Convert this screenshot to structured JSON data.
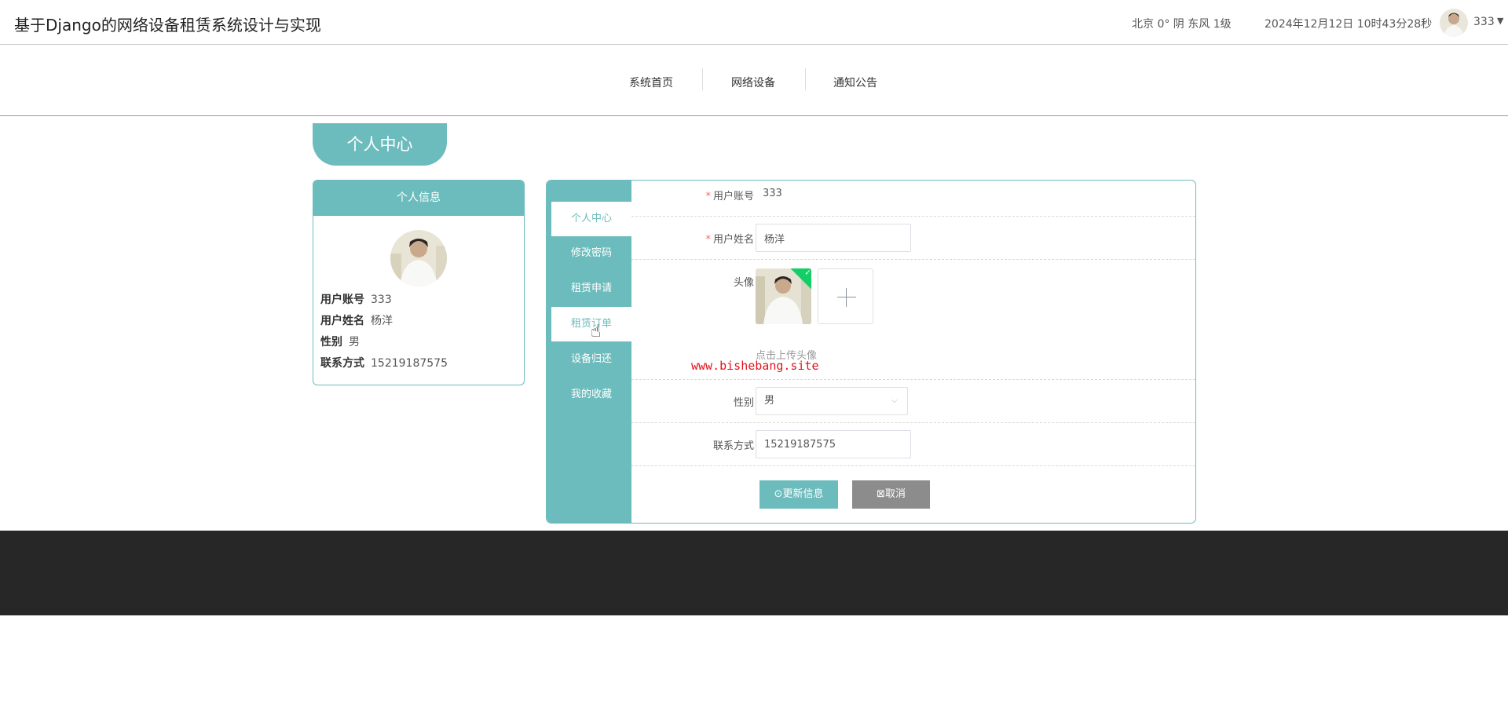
{
  "header": {
    "site_title": "基于Django的网络设备租赁系统设计与实现",
    "weather": "北京  0°  阴  东风  1级",
    "datetime": "2024年12月12日 10时43分28秒",
    "username": "333",
    "avatar_icon": "user-avatar-icon"
  },
  "nav": {
    "items": [
      {
        "label": "系统首页"
      },
      {
        "label": "网络设备"
      },
      {
        "label": "通知公告"
      }
    ]
  },
  "page": {
    "title_tab": "个人中心"
  },
  "profile_card": {
    "title": "个人信息",
    "rows": [
      {
        "key": "用户账号",
        "value": "333"
      },
      {
        "key": "用户姓名",
        "value": "杨洋"
      },
      {
        "key": "性别",
        "value": "男"
      },
      {
        "key": "联系方式",
        "value": "15219187575"
      }
    ]
  },
  "side_menu": {
    "items": [
      {
        "label": "个人中心",
        "active": true
      },
      {
        "label": "修改密码"
      },
      {
        "label": "租赁申请"
      },
      {
        "label": "租赁订单"
      },
      {
        "label": "设备归还"
      },
      {
        "label": "我的收藏"
      }
    ]
  },
  "form": {
    "account_label": "用户账号",
    "account_value": "333",
    "name_label": "用户姓名",
    "name_value": "杨洋",
    "avatar_label": "头像",
    "upload_tip": "点击上传头像",
    "gender_label": "性别",
    "gender_value": "男",
    "phone_label": "联系方式",
    "phone_value": "15219187575",
    "update_button": "更新信息",
    "cancel_button": "取消"
  },
  "watermark": "www.bishebang.site",
  "colors": {
    "accent": "#6dbcbd",
    "footer": "#272727",
    "cancel": "#8c8c8c",
    "watermark": "#e4121b"
  }
}
